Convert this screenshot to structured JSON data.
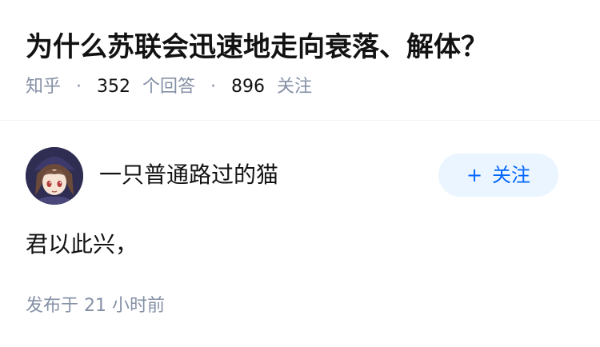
{
  "question": {
    "title": "为什么苏联会迅速地走向衰落、解体？",
    "meta": {
      "site": "知乎",
      "separator": "·",
      "answer_count": "352",
      "answer_unit": "个回答",
      "follower_count": "896",
      "follower_unit": "关注"
    }
  },
  "answer": {
    "author": {
      "name": "一只普通路过的猫",
      "avatar_icon": "anime-girl-avatar",
      "follow_plus": "+",
      "follow_label": "关注"
    },
    "content": "君以此兴，",
    "published": "发布于 21 小时前"
  },
  "colors": {
    "title": "#121212",
    "meta_gray": "#8590a6",
    "follow_bg": "#ebf5ff",
    "follow_text": "#0066ff",
    "divider": "#f0f2f7"
  }
}
